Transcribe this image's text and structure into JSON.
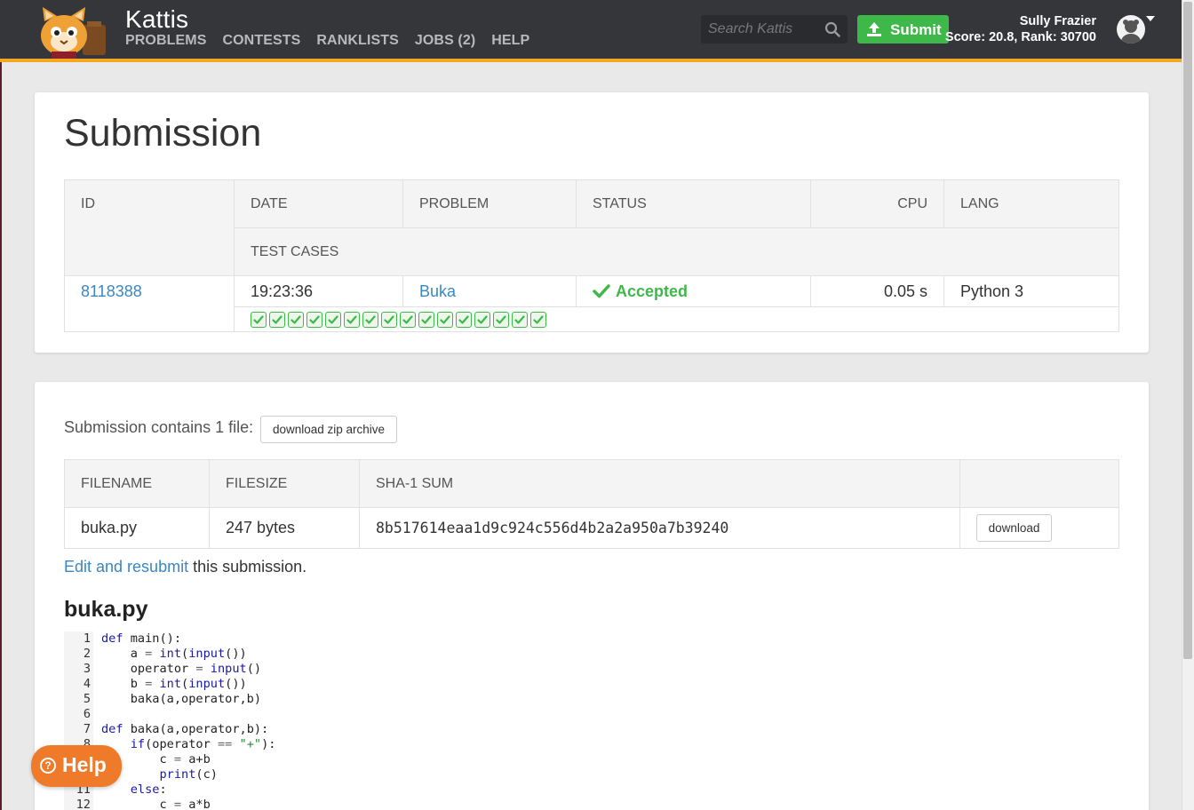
{
  "nav": {
    "brand": "Kattis",
    "links": [
      "PROBLEMS",
      "CONTESTS",
      "RANKLISTS",
      "JOBS (2)",
      "HELP"
    ],
    "search_placeholder": "Search Kattis",
    "submit_label": "Submit",
    "user_name": "Sully Frazier",
    "user_score": "Score: 20.8, Rank: 30700"
  },
  "submission": {
    "title": "Submission",
    "headers": {
      "id": "ID",
      "date": "DATE",
      "problem": "PROBLEM",
      "status": "STATUS",
      "cpu": "CPU",
      "lang": "LANG",
      "test_cases": "TEST CASES"
    },
    "id": "8118388",
    "date": "19:23:36",
    "problem": "Buka",
    "status": "Accepted",
    "cpu": "0.05 s",
    "lang": "Python 3",
    "test_cases_passed": 16
  },
  "files": {
    "intro": "Submission contains 1 file:",
    "zip_button": "download zip archive",
    "headers": {
      "filename": "FILENAME",
      "filesize": "FILESIZE",
      "sha1": "SHA-1 SUM"
    },
    "rows": [
      {
        "filename": "buka.py",
        "filesize": "247 bytes",
        "sha1": "8b517614eaa1d9c924c556d4b2a2a950a7b39240",
        "download": "download"
      }
    ],
    "resubmit_link": "Edit and resubmit",
    "resubmit_rest": " this submission.",
    "code_title": "buka.py"
  },
  "code_lines": [
    "def main():",
    "    a = int(input())",
    "    operator = input()",
    "    b = int(input())",
    "    baka(a,operator,b)",
    "",
    "def baka(a,operator,b):",
    "    if(operator == \"+\"):",
    "        c = a+b",
    "        print(c)",
    "    else:",
    "        c = a*b"
  ],
  "help": {
    "label": "Help"
  }
}
